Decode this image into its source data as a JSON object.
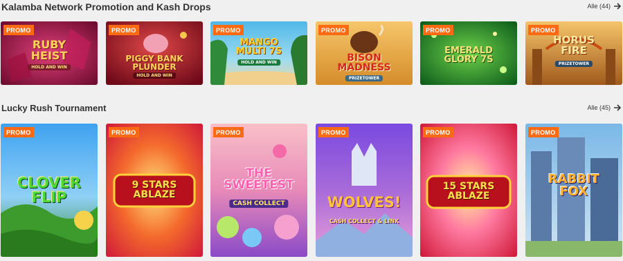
{
  "sections": [
    {
      "title": "Kalamba Network Promotion and Kash Drops",
      "see_all": "Alle (44)",
      "games": [
        {
          "badge": "PROMO",
          "title_lines": [
            "Ruby",
            "Heist"
          ],
          "subtitle": "HOLD AND WIN"
        },
        {
          "badge": "PROMO",
          "title_lines": [
            "Piggy Bank",
            "Plunder"
          ],
          "subtitle": "HOLD AND WIN"
        },
        {
          "badge": "PROMO",
          "title_lines": [
            "Mango",
            "Multi 7s"
          ],
          "subtitle": "HOLD AND WIN"
        },
        {
          "badge": "PROMO",
          "title_lines": [
            "Bison",
            "Madness"
          ],
          "subtitle": "PRIZETOWER"
        },
        {
          "badge": "PROMO",
          "title_lines": [
            "Emerald",
            "Glory 7s"
          ],
          "subtitle": ""
        },
        {
          "badge": "PROMO",
          "title_lines": [
            "Horus",
            "Fire"
          ],
          "subtitle": "PRIZETOWER"
        }
      ]
    },
    {
      "title": "Lucky Rush Tournament",
      "see_all": "Alle (45)",
      "games": [
        {
          "badge": "PROMO",
          "title_lines": [
            "Clover",
            "Flip"
          ],
          "subtitle": ""
        },
        {
          "badge": "PROMO",
          "title_lines": [
            "9 Stars",
            "Ablaze"
          ],
          "subtitle": ""
        },
        {
          "badge": "PROMO",
          "title_lines": [
            "The",
            "Sweetest"
          ],
          "subtitle": "CASH COLLECT"
        },
        {
          "badge": "PROMO",
          "title_lines": [
            "Wolves!"
          ],
          "subtitle": "CASH COLLECT & LINK"
        },
        {
          "badge": "PROMO",
          "title_lines": [
            "15 Stars",
            "Ablaze"
          ],
          "subtitle": ""
        },
        {
          "badge": "PROMO",
          "title_lines": [
            "Rabbit",
            "Fox"
          ],
          "subtitle": ""
        }
      ]
    }
  ],
  "colors": {
    "promo_badge": "#ff6a13",
    "background": "#f0f0f0"
  },
  "icons": {
    "see_all": "arrow-right-icon"
  }
}
